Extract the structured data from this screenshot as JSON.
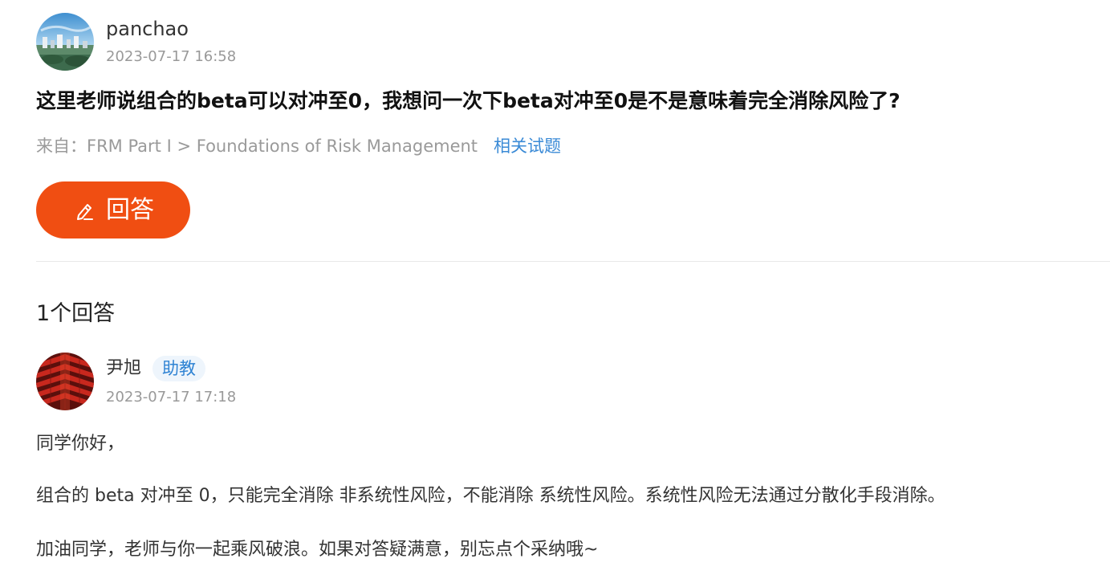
{
  "question": {
    "author": {
      "name": "panchao",
      "time": "2023-07-17 16:58",
      "avatar_icon": "city-landscape-avatar"
    },
    "title": "这里老师说组合的beta可以对冲至0，我想问一次下beta对冲至0是不是意味着完全消除风险了?",
    "source_prefix": "来自：",
    "source_path": "FRM Part I > Foundations of Risk Management",
    "related_link": "相关试题",
    "answer_button_label": "回答",
    "answer_button_icon": "pencil-icon"
  },
  "answers_count_label": "1个回答",
  "answer": {
    "author": {
      "name": "尹旭",
      "badge": "助教",
      "time": "2023-07-17 17:18",
      "avatar_icon": "red-pagoda-roof-avatar"
    },
    "paragraphs": [
      "同学你好，",
      "组合的 beta 对冲至 0，只能完全消除 非系统性风险，不能消除 系统性风险。系统性风险无法通过分散化手段消除。",
      "加油同学，老师与你一起乘风破浪。如果对答疑满意，别忘点个采纳哦~"
    ]
  },
  "colors": {
    "accent_orange": "#f04e12",
    "link_blue": "#3a8ad6",
    "muted_gray": "#999999",
    "badge_bg": "#eef5fc"
  }
}
